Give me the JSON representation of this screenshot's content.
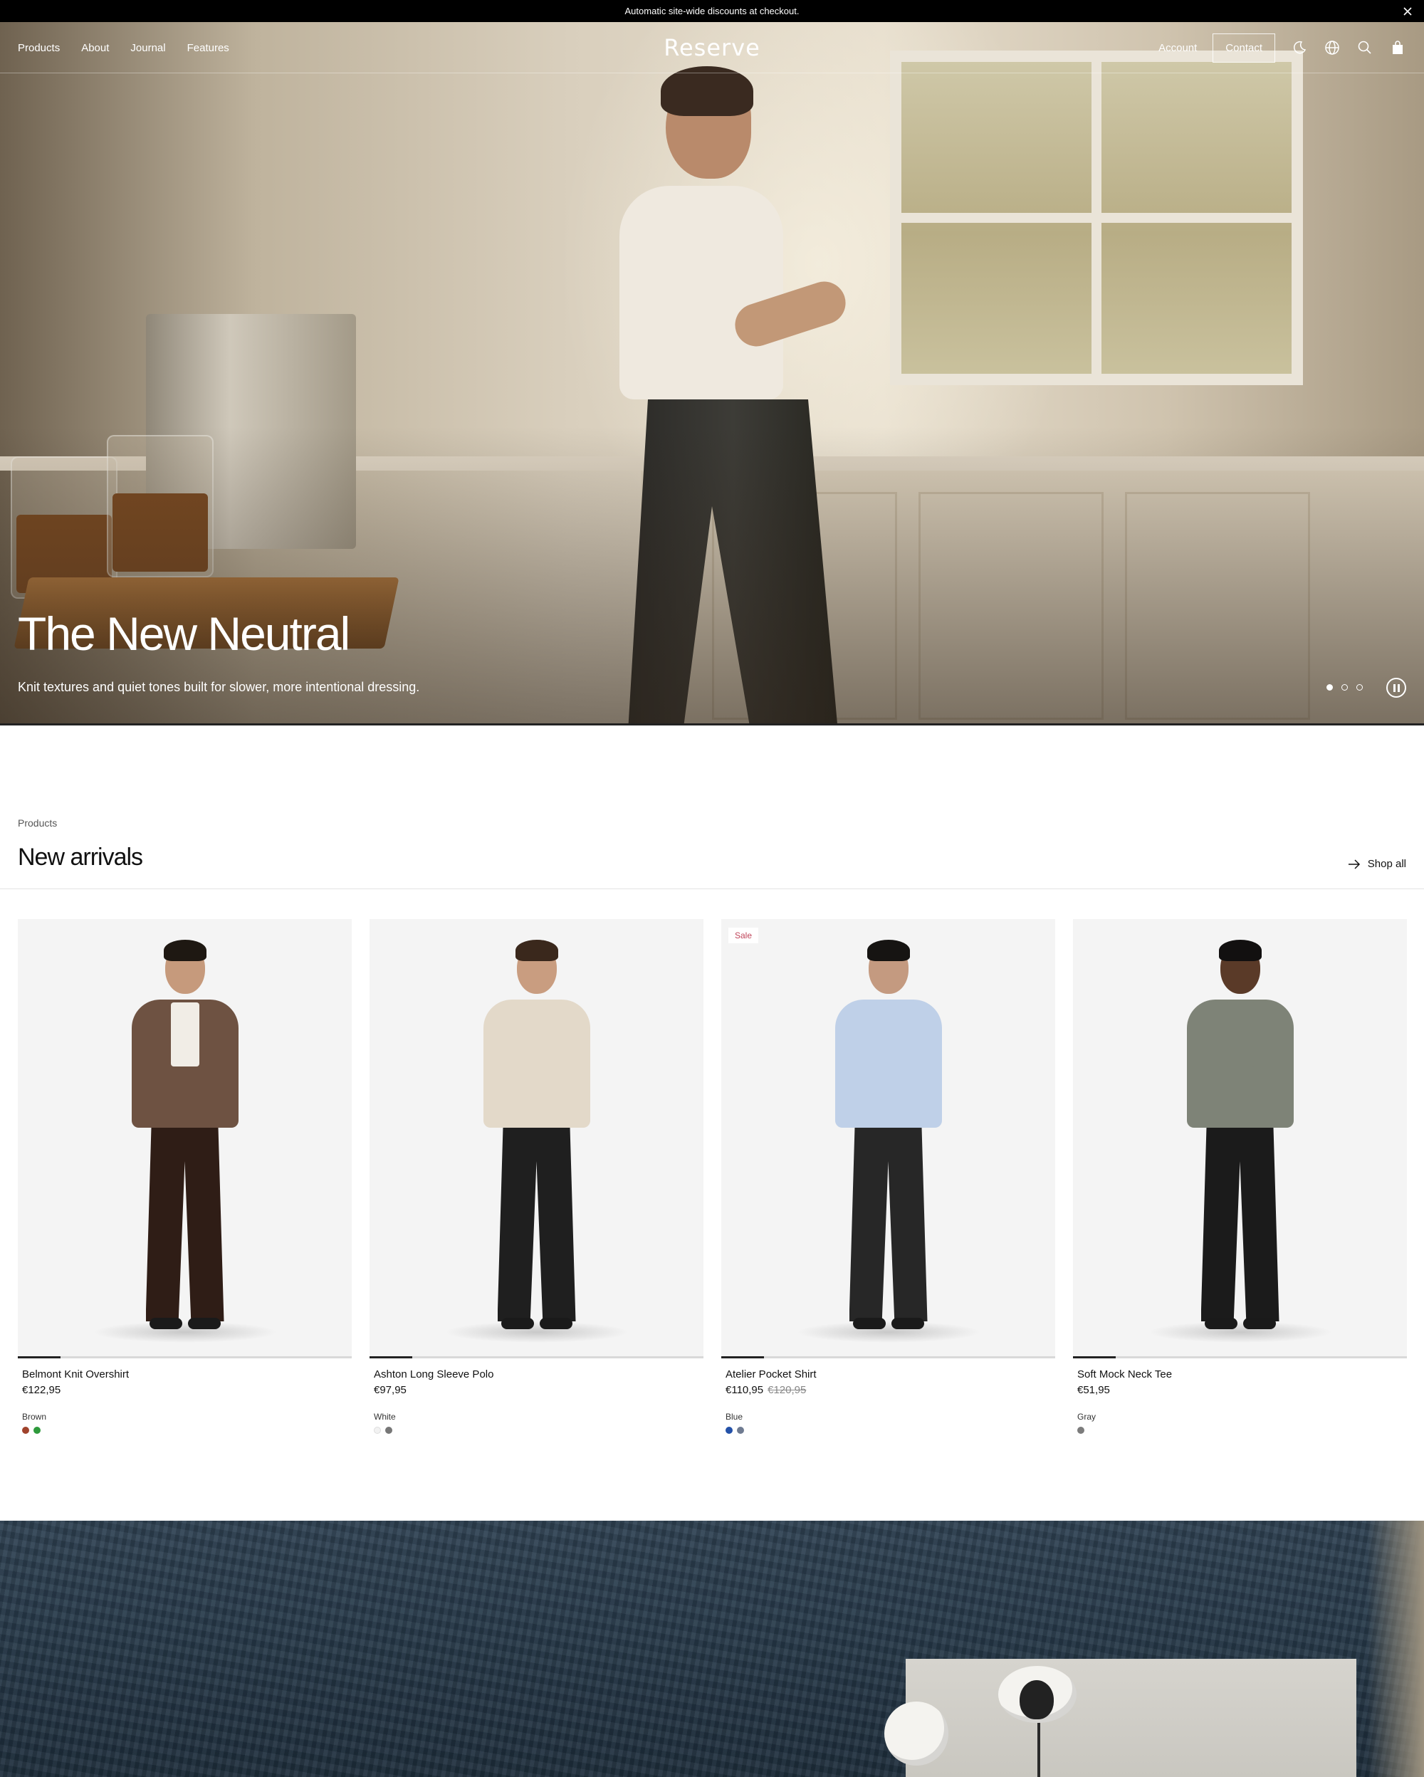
{
  "announcement": {
    "text": "Automatic site-wide discounts at checkout."
  },
  "nav": {
    "links": [
      "Products",
      "About",
      "Journal",
      "Features"
    ],
    "logo": "Reserve",
    "account": "Account",
    "contact": "Contact"
  },
  "hero": {
    "title": "The New Neutral",
    "subtitle": "Knit textures and quiet tones built for slower, more intentional dressing.",
    "slide_count": 3,
    "active_slide": 1
  },
  "new_arrivals": {
    "label": "Products",
    "title": "New arrivals",
    "shop_all": "Shop all",
    "products": [
      {
        "name": "Belmont Knit Overshirt",
        "price": "€122,95",
        "old_price": "",
        "badge": "",
        "color_label": "Brown",
        "swatches": [
          "#a0432c",
          "#2e9a3c"
        ],
        "top": "#6e5242",
        "pants": "#2f1d16",
        "inner": "#f1ede6",
        "skin": "#c69a7c",
        "hair": "#1e1812"
      },
      {
        "name": "Ashton Long Sleeve Polo",
        "price": "€97,95",
        "old_price": "",
        "badge": "",
        "color_label": "White",
        "swatches": [
          "#f2f2f2",
          "#777777"
        ],
        "top": "#e3d9c9",
        "pants": "#1f1f1f",
        "inner": "#e3d9c9",
        "skin": "#c99d80",
        "hair": "#3a281c"
      },
      {
        "name": "Atelier Pocket Shirt",
        "price": "€110,95",
        "old_price": "€120,95",
        "badge": "Sale",
        "color_label": "Blue",
        "swatches": [
          "#2451a8",
          "#6f7b91"
        ],
        "top": "#bfd0e8",
        "pants": "#272727",
        "inner": "#bfd0e8",
        "skin": "#c49a80",
        "hair": "#161412"
      },
      {
        "name": "Soft Mock Neck Tee",
        "price": "€51,95",
        "old_price": "",
        "badge": "",
        "color_label": "Gray",
        "swatches": [
          "#7c7c7c"
        ],
        "top": "#7e8377",
        "pants": "#1b1b1b",
        "inner": "#7e8377",
        "skin": "#5a3a28",
        "hair": "#121010"
      }
    ]
  }
}
